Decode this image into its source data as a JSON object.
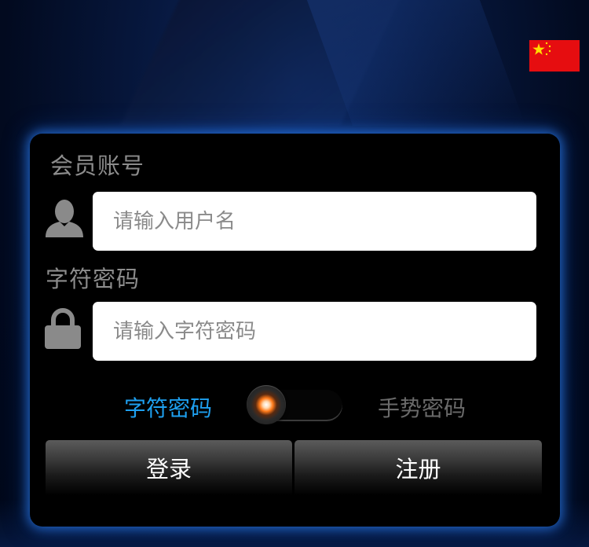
{
  "login_form": {
    "username_label": "会员账号",
    "username_placeholder": "请输入用户名",
    "password_label": "字符密码",
    "password_placeholder": "请输入字符密码",
    "mode_char_label": "字符密码",
    "mode_gesture_label": "手势密码",
    "login_button": "登录",
    "register_button": "注册"
  },
  "language": {
    "flag_icon": "china-flag-icon"
  },
  "colors": {
    "accent_blue": "#1ea0f0",
    "glow": "#2878e6",
    "flag_red": "#e60d10",
    "flag_yellow": "#ffde00"
  }
}
